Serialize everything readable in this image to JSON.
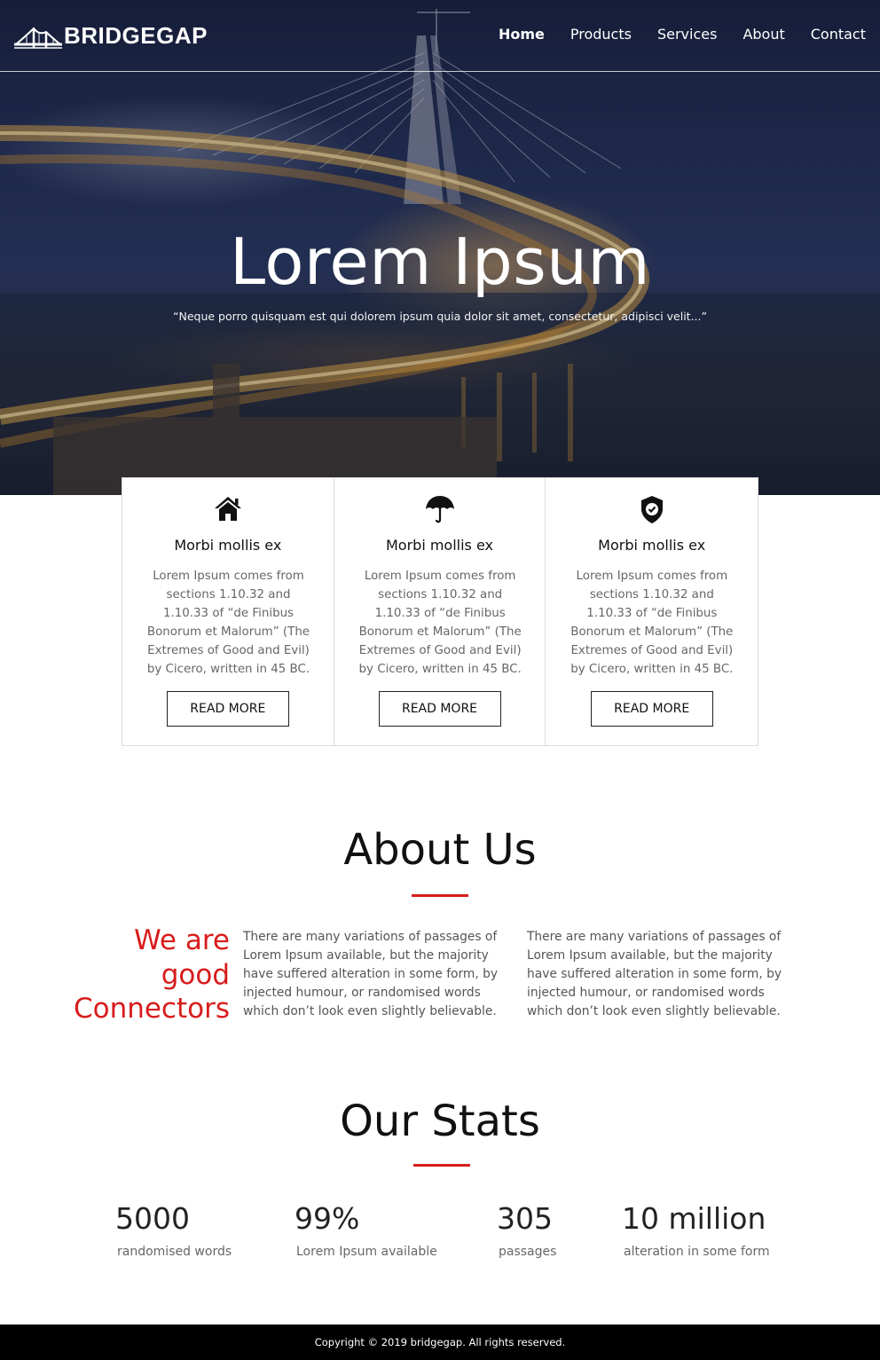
{
  "header": {
    "brand": "BRIDGEGAP",
    "nav": [
      {
        "label": "Home",
        "active": true
      },
      {
        "label": "Products",
        "active": false
      },
      {
        "label": "Services",
        "active": false
      },
      {
        "label": "About",
        "active": false
      },
      {
        "label": "Contact",
        "active": false
      }
    ]
  },
  "hero": {
    "title": "Lorem Ipsum",
    "subtitle": "“Neque porro quisquam est qui dolorem ipsum quia dolor sit amet, consectetur, adipisci velit...”"
  },
  "features": [
    {
      "icon": "home-icon",
      "title": "Morbi mollis ex",
      "text": "Lorem Ipsum comes from sections 1.10.32 and 1.10.33 of “de Finibus Bonorum et Malorum” (The Extremes of Good and Evil) by Cicero, written in 45 BC.",
      "button": "READ MORE"
    },
    {
      "icon": "umbrella-icon",
      "title": "Morbi mollis ex",
      "text": "Lorem Ipsum comes from sections 1.10.32 and 1.10.33 of “de Finibus Bonorum et Malorum” (The Extremes of Good and Evil) by Cicero, written in 45 BC.",
      "button": "READ MORE"
    },
    {
      "icon": "shield-check-icon",
      "title": "Morbi mollis ex",
      "text": "Lorem Ipsum comes from sections 1.10.32 and 1.10.33 of “de Finibus Bonorum et Malorum” (The Extremes of Good and Evil) by Cicero, written in 45 BC.",
      "button": "READ MORE"
    }
  ],
  "about": {
    "title": "About Us",
    "tagline_lines": [
      "We are",
      "good",
      "Connectors"
    ],
    "col1": "There are many variations of passages of Lorem Ipsum available, but the majority have suffered alteration in some form, by injected humour, or randomised words which don’t look even slightly believable.",
    "col2": "There are many variations of passages of Lorem Ipsum available, but the majority have suffered alteration in some form, by injected humour, or randomised words which don’t look even slightly believable."
  },
  "stats": {
    "title": "Our Stats",
    "items": [
      {
        "value": "5000",
        "label": "randomised words"
      },
      {
        "value": "99%",
        "label": "Lorem Ipsum available"
      },
      {
        "value": "305",
        "label": "passages"
      },
      {
        "value": "10 million",
        "label": "alteration in some form"
      }
    ]
  },
  "footer": {
    "copyright": "Copyright © 2019 bridgegap. All rights reserved."
  },
  "colors": {
    "accent": "#d81c1c",
    "footer_bg": "#000000",
    "hero_overlay": "#1a2240"
  }
}
